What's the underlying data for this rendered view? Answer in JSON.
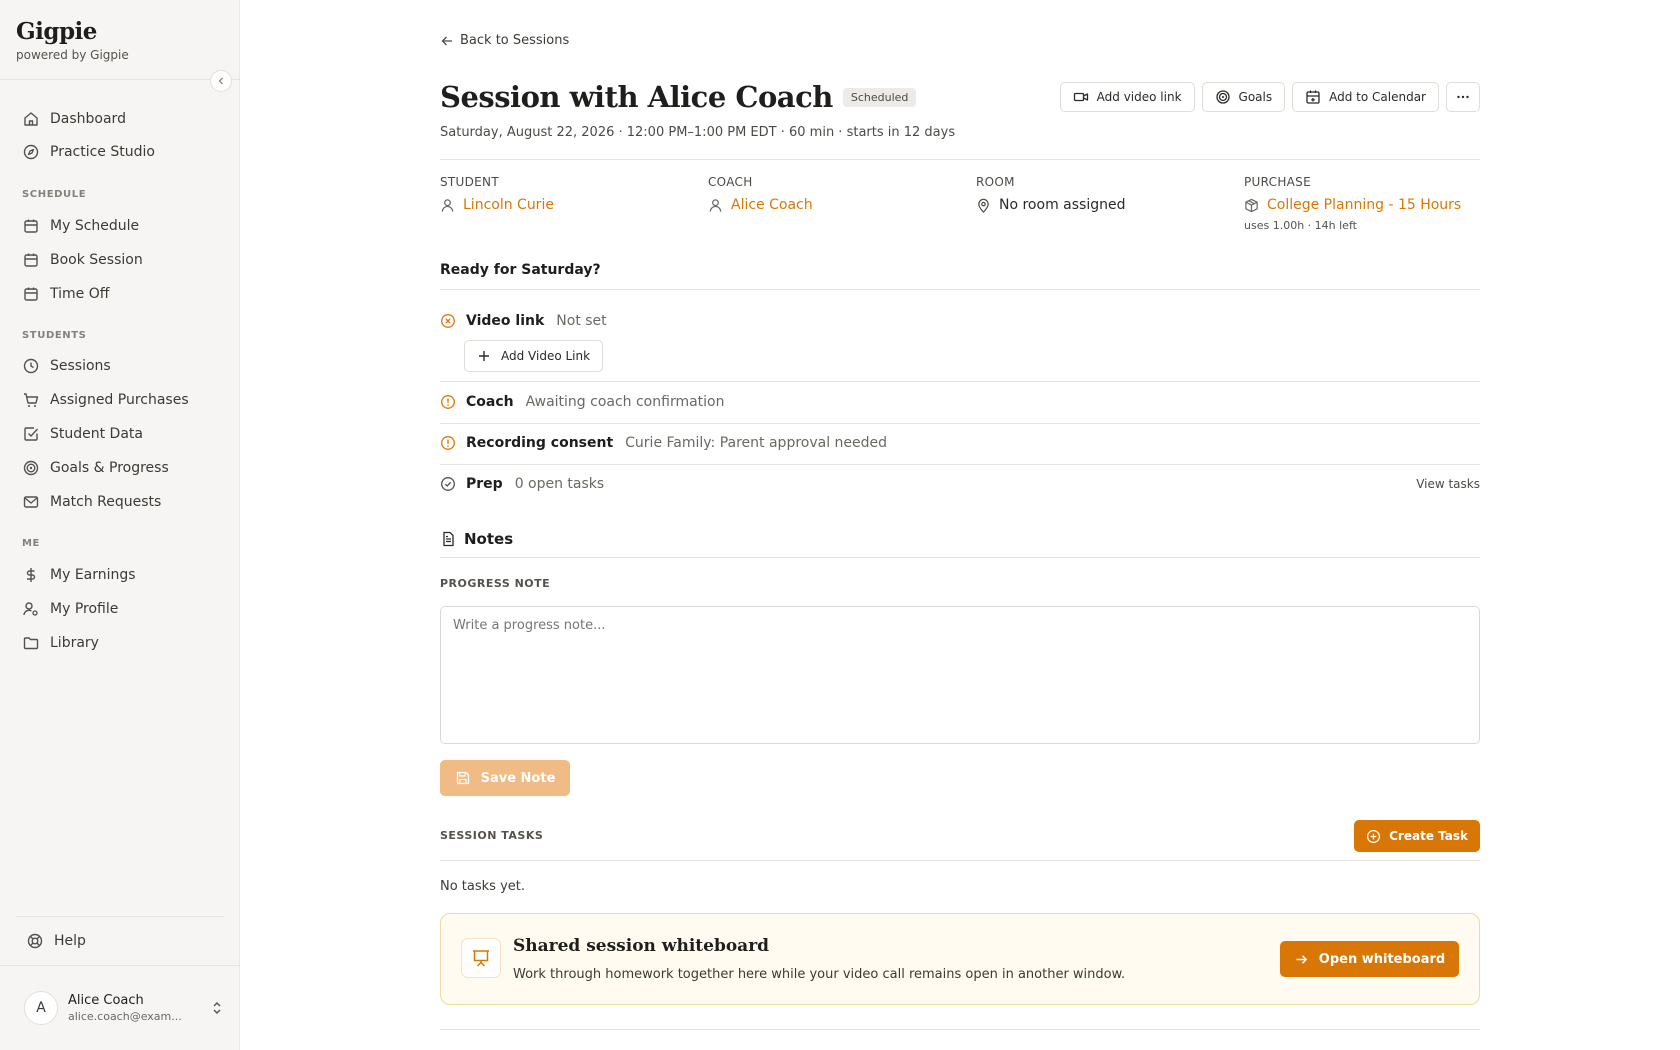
{
  "brand": {
    "name": "Gigpie",
    "tagline": "powered by Gigpie"
  },
  "sidebar": {
    "primary": [
      {
        "label": "Dashboard",
        "icon": "home-icon"
      },
      {
        "label": "Practice Studio",
        "icon": "compass-icon"
      }
    ],
    "sections": [
      {
        "title": "SCHEDULE",
        "items": [
          {
            "label": "My Schedule",
            "icon": "calendar-icon"
          },
          {
            "label": "Book Session",
            "icon": "calendar-icon"
          },
          {
            "label": "Time Off",
            "icon": "calendar-icon"
          }
        ]
      },
      {
        "title": "STUDENTS",
        "items": [
          {
            "label": "Sessions",
            "icon": "clock-icon"
          },
          {
            "label": "Assigned Purchases",
            "icon": "cart-icon"
          },
          {
            "label": "Student Data",
            "icon": "checkbox-icon"
          },
          {
            "label": "Goals & Progress",
            "icon": "target-icon"
          },
          {
            "label": "Match Requests",
            "icon": "mail-icon"
          }
        ]
      },
      {
        "title": "ME",
        "items": [
          {
            "label": "My Earnings",
            "icon": "dollar-icon"
          },
          {
            "label": "My Profile",
            "icon": "user-cog-icon"
          },
          {
            "label": "Library",
            "icon": "folder-icon"
          }
        ]
      }
    ],
    "help": "Help",
    "user": {
      "initial": "A",
      "name": "Alice Coach",
      "email": "alice.coach@exam..."
    }
  },
  "header": {
    "back_label": "Back to Sessions",
    "title": "Session with Alice Coach",
    "status": "Scheduled",
    "subtitle": "Saturday, August 22, 2026 · 12:00 PM–1:00 PM EDT · 60 min · starts in 12 days",
    "actions": {
      "video": "Add video link",
      "goals": "Goals",
      "calendar": "Add to Calendar"
    }
  },
  "meta": {
    "student": {
      "label": "STUDENT",
      "value": "Lincoln Curie"
    },
    "coach": {
      "label": "COACH",
      "value": "Alice Coach"
    },
    "room": {
      "label": "ROOM",
      "value": "No room assigned"
    },
    "purchase": {
      "label": "PURCHASE",
      "value": "College Planning - 15 Hours",
      "note": "uses 1.00h · 14h left"
    }
  },
  "readiness": {
    "heading": "Ready for Saturday?",
    "video": {
      "label": "Video link",
      "value": "Not set",
      "button": "Add Video Link"
    },
    "coach": {
      "label": "Coach",
      "value": "Awaiting coach confirmation"
    },
    "consent": {
      "label": "Recording consent",
      "value": "Curie Family: Parent approval needed"
    },
    "prep": {
      "label": "Prep",
      "value": "0 open tasks",
      "link": "View tasks"
    }
  },
  "notes": {
    "heading": "Notes",
    "progress_label": "PROGRESS NOTE",
    "placeholder": "Write a progress note...",
    "save_label": "Save Note"
  },
  "tasks": {
    "label": "SESSION TASKS",
    "create_label": "Create Task",
    "empty": "No tasks yet."
  },
  "whiteboard": {
    "title": "Shared session whiteboard",
    "description": "Work through homework together here while your video call remains open in another window.",
    "button": "Open whiteboard"
  },
  "colors": {
    "accent": "#d97706",
    "accent_disabled": "#f0bb85",
    "sidebar_bg": "#f6f5f3",
    "warning": "#d97706"
  }
}
